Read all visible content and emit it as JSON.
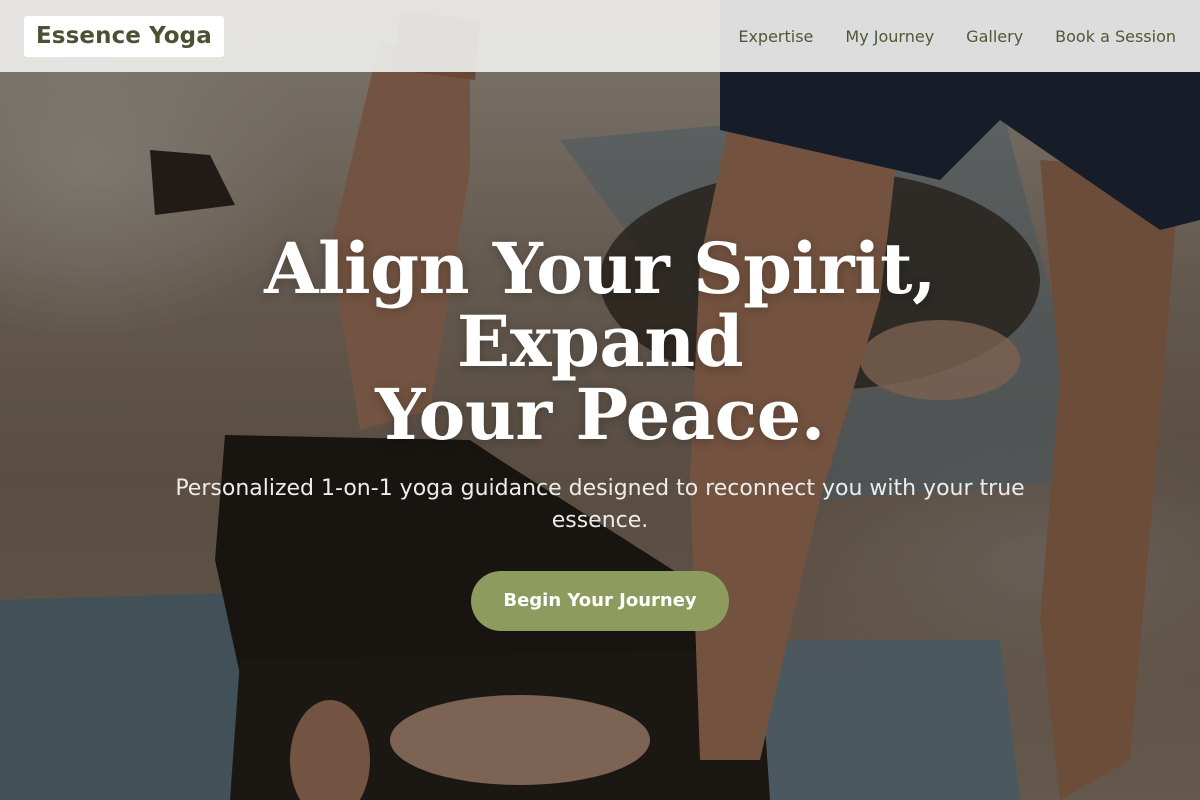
{
  "nav": {
    "brand": "Essence Yoga",
    "links": [
      {
        "label": "Expertise"
      },
      {
        "label": "My Journey"
      },
      {
        "label": "Gallery"
      },
      {
        "label": "Book a Session"
      }
    ]
  },
  "hero": {
    "title_line1": "Align Your Spirit, Expand",
    "title_line2": "Your Peace.",
    "subtitle": "Personalized 1-on-1 yoga guidance designed to reconnect you with your true essence.",
    "cta_label": "Begin Your Journey",
    "background_image": "yoga-practice-photo"
  },
  "colors": {
    "brand_text": "#4a5233",
    "accent_button": "#8d9b5e",
    "nav_background": "#ecece9"
  }
}
